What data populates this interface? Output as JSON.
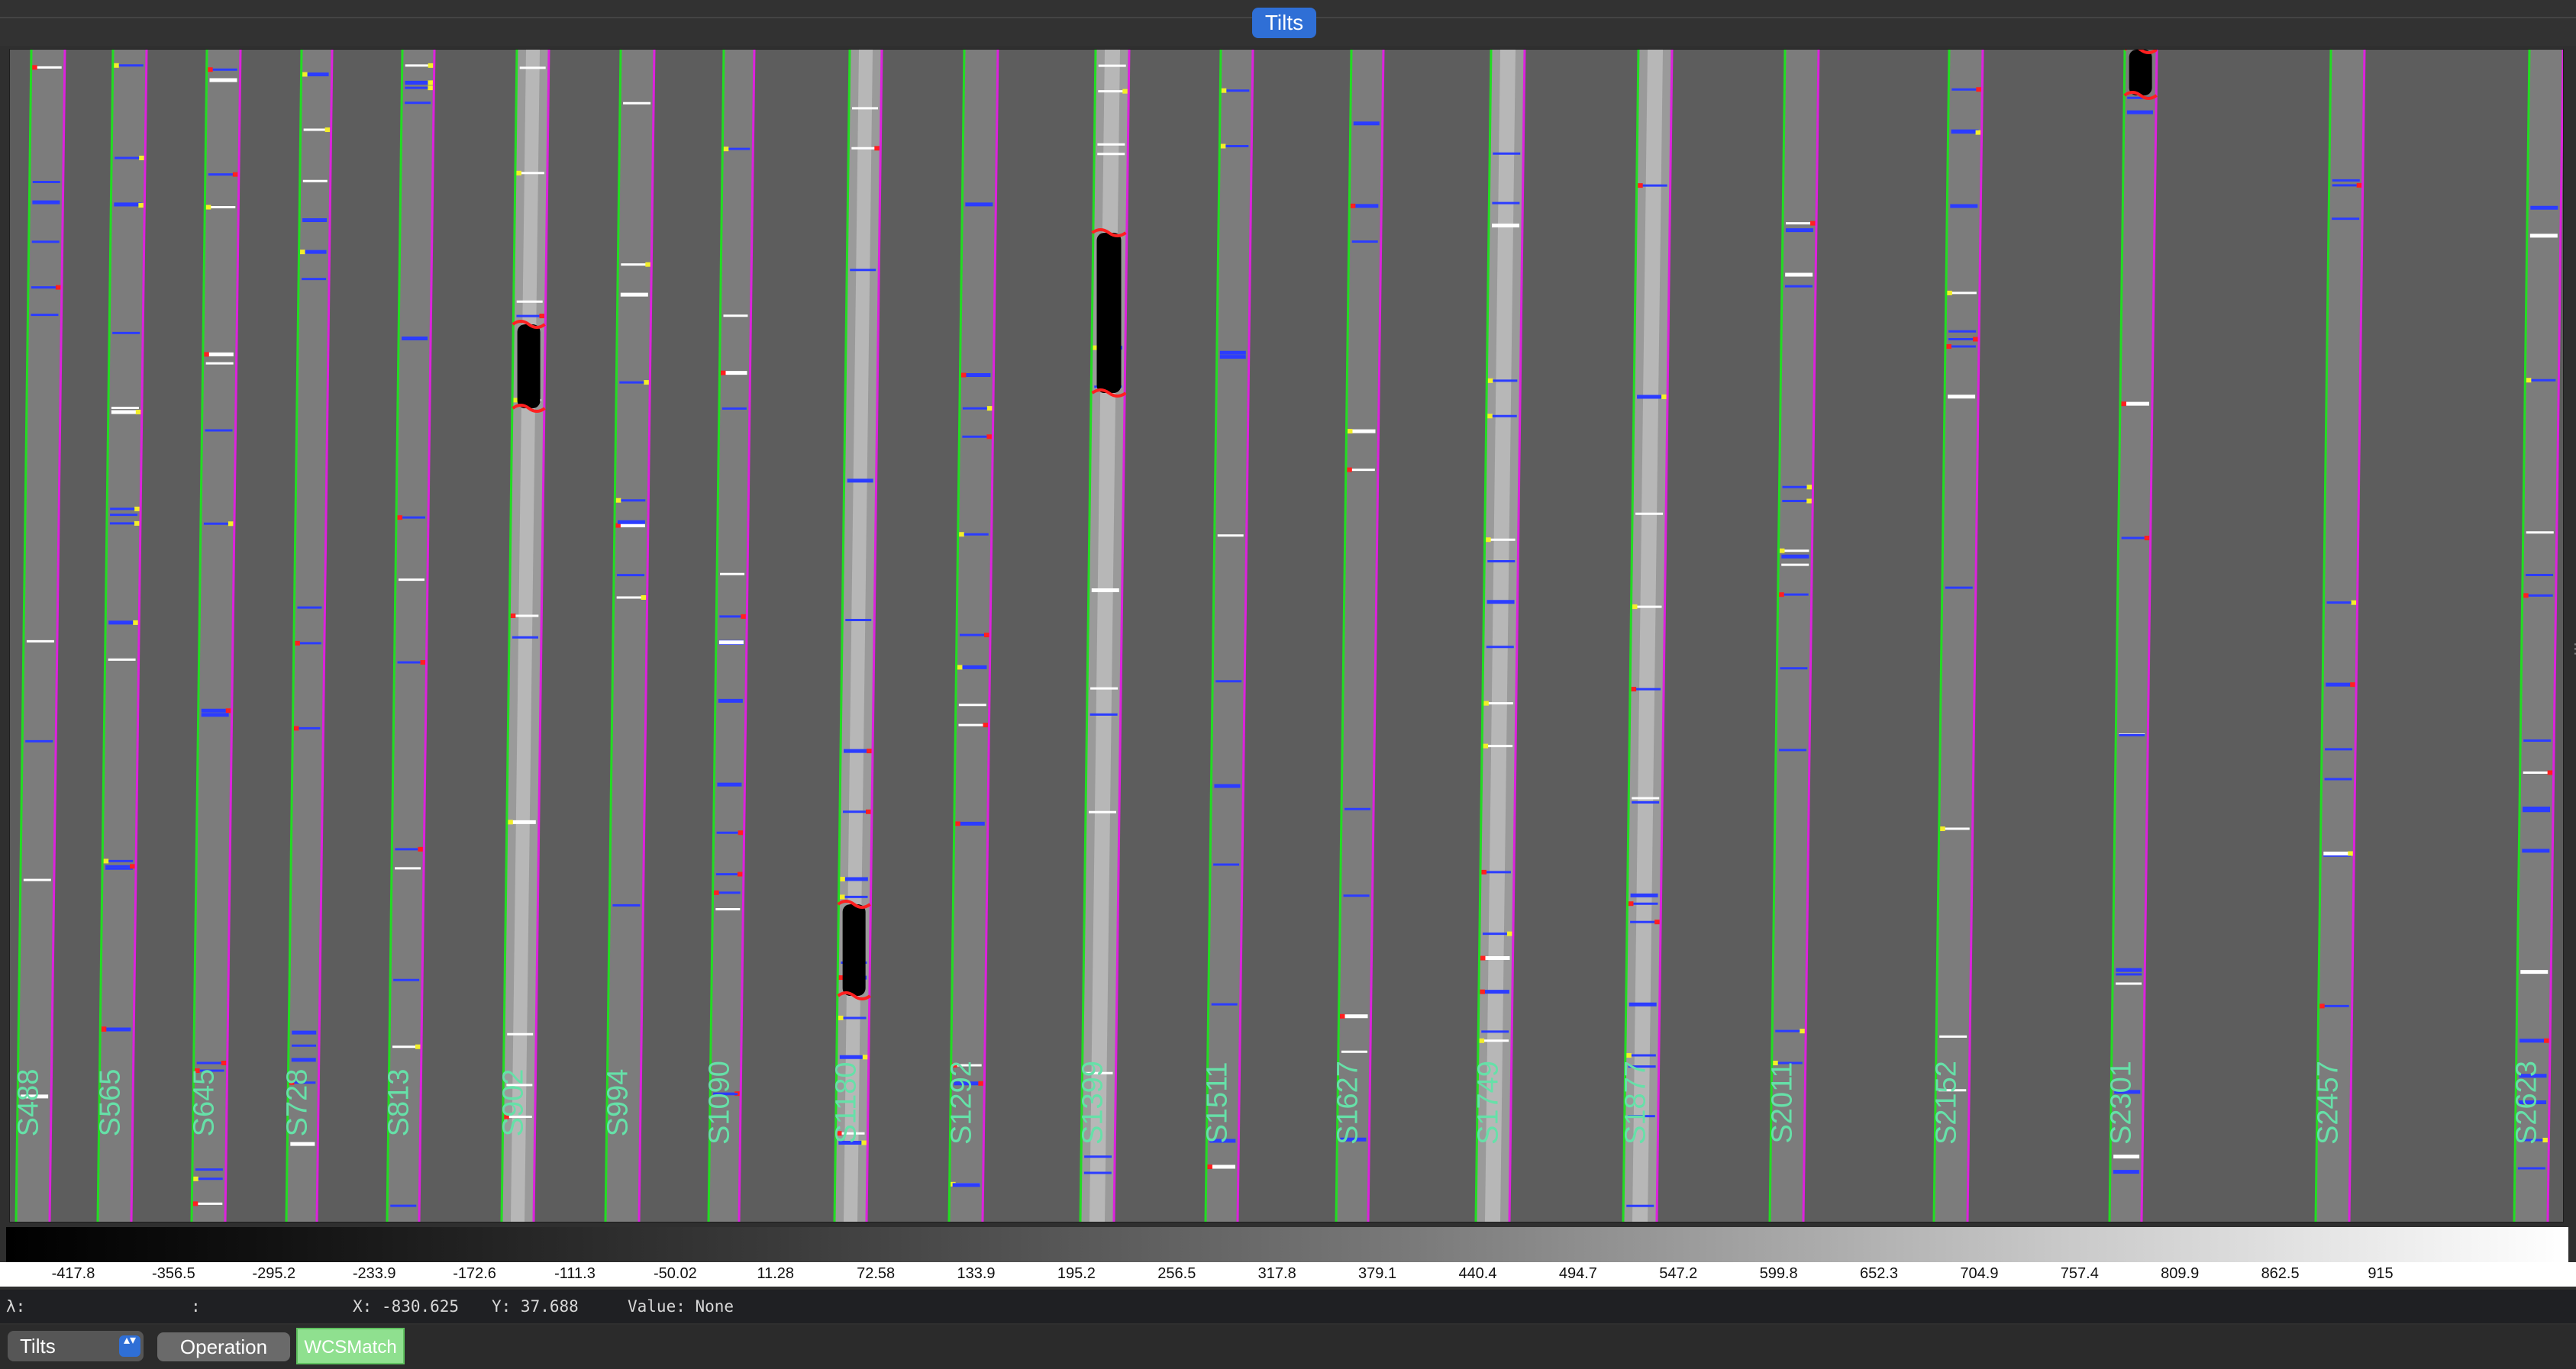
{
  "window": {
    "active_tab": "Tilts"
  },
  "image": {
    "slit_labels": [
      "S488",
      "S565",
      "S645",
      "S728",
      "S813",
      "S902",
      "S994",
      "S1090",
      "S1180",
      "S1292",
      "S1399",
      "S1511",
      "S1627",
      "S1749",
      "S1877",
      "S2011",
      "S2152",
      "S2301",
      "S2457",
      "S2623"
    ],
    "colors": {
      "left_edge": "#22dd22",
      "right_edge": "#dd22dd",
      "label": "#66e0a8",
      "background": "#5d5d5d",
      "saturated": "#000000",
      "flag_red": "#ff2020",
      "line_blue": "#2b3cff",
      "line_yellow": "#f2ee2a"
    }
  },
  "colorbar": {
    "ticks": [
      "-417.8",
      "-356.5",
      "-295.2",
      "-233.9",
      "-172.6",
      "-111.3",
      "-50.02",
      "11.28",
      "72.58",
      "133.9",
      "195.2",
      "256.5",
      "317.8",
      "379.1",
      "440.4",
      "494.7",
      "547.2",
      "599.8",
      "652.3",
      "704.9",
      "757.4",
      "809.9",
      "862.5",
      "915"
    ]
  },
  "status": {
    "lambda_label": "λ:",
    "colon": ":",
    "x_label": "X: -830.625",
    "y_label": "Y: 37.688",
    "value_label": "Value: None"
  },
  "toolbar": {
    "mode_value": "Tilts",
    "mode_arrows": "▴▾",
    "operation_label": "Operation",
    "wcsmatch_label": "WCSMatch"
  }
}
